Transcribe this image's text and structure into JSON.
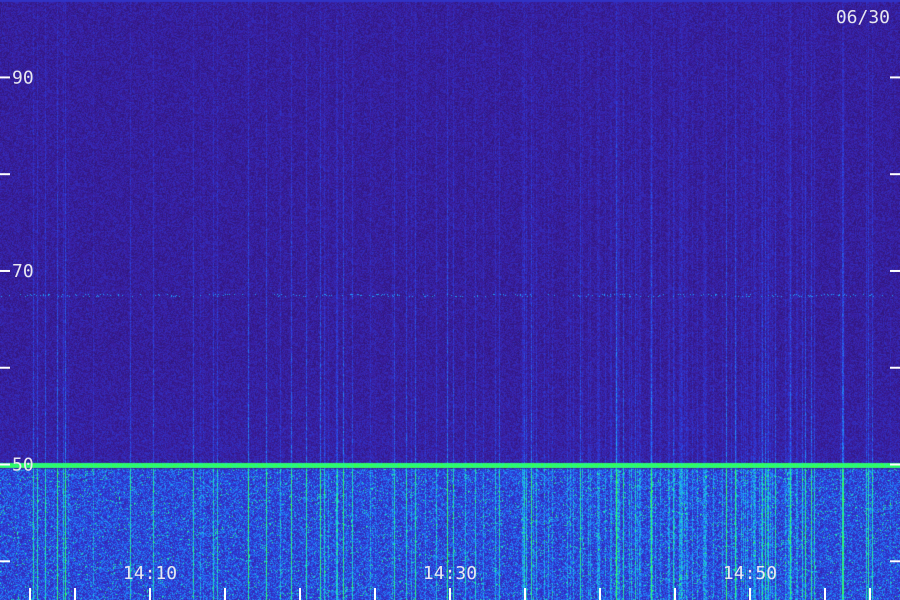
{
  "date_label": "06/30",
  "chart_data": {
    "type": "heatmap",
    "title": "",
    "xlabel": "",
    "ylabel": "",
    "x_tick_labels": [
      "14:10",
      "14:30",
      "14:50"
    ],
    "y_tick_labels": [
      "90",
      "70",
      "50"
    ],
    "y_range": [
      36,
      98
    ],
    "y_minor_ticks": [
      30,
      40,
      50,
      60,
      70,
      80,
      90
    ],
    "x_range_minutes": [
      0,
      60
    ],
    "x_labeled_minutes": [
      10,
      30,
      50
    ],
    "x_minor_minutes": [
      2,
      5,
      10,
      15,
      20,
      25,
      30,
      35,
      40,
      45,
      50,
      55,
      58
    ],
    "grid": false,
    "colormap": [
      "#2a1160",
      "#3a1ea0",
      "#2b3fe0",
      "#1fa0ff",
      "#1ff0b0",
      "#38ff48"
    ],
    "features": [
      {
        "name": "steady line",
        "y": 50,
        "intensity": "high"
      },
      {
        "name": "faint line",
        "y": 98,
        "intensity": "low"
      },
      {
        "name": "dotted line",
        "y": 67.5,
        "intensity": "medium"
      }
    ]
  },
  "colors": {
    "background": "#2a1160",
    "signal_low": "#3a1ea0",
    "signal_mid": "#2b3fe0",
    "signal_high": "#38ff48",
    "label": "#e8e8f0"
  }
}
